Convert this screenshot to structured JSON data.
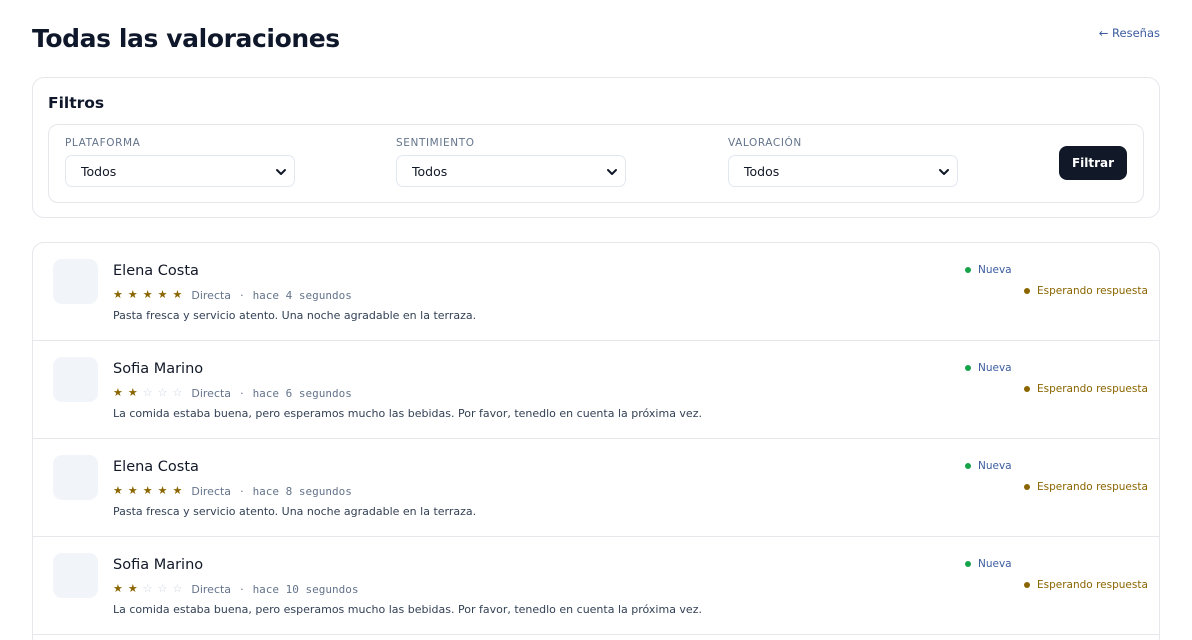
{
  "header": {
    "title": "Todas las valoraciones",
    "back_link": "← Reseñas"
  },
  "filters": {
    "title": "Filtros",
    "platform": {
      "label": "PLATAFORMA",
      "value": "Todos"
    },
    "sentiment": {
      "label": "SENTIMIENTO",
      "value": "Todos"
    },
    "rating": {
      "label": "VALORACIÓN",
      "value": "Todos"
    },
    "button_label": "Filtrar"
  },
  "colors": {
    "star_filled": "#8a6500",
    "star_empty": "#cbd5e1",
    "status_new_dot": "#16a34a",
    "status_wait_dot": "#8a6500",
    "button_bg": "#111827"
  },
  "icons": {
    "star": "★",
    "star_empty": "☆",
    "chevron": "chevron-down-icon"
  },
  "reviews": [
    {
      "name": "Elena Costa",
      "rating": 5,
      "max_rating": 5,
      "platform": "Directa",
      "separator": "·",
      "time": "hace 4 segundos",
      "text": "Pasta fresca y servicio atento. Una noche agradable en la terraza.",
      "status_new": "Nueva",
      "status_wait": "Esperando respuesta"
    },
    {
      "name": "Sofia Marino",
      "rating": 2,
      "max_rating": 5,
      "platform": "Directa",
      "separator": "·",
      "time": "hace 6 segundos",
      "text": "La comida estaba buena, pero esperamos mucho las bebidas. Por favor, tenedlo en cuenta la próxima vez.",
      "status_new": "Nueva",
      "status_wait": "Esperando respuesta"
    },
    {
      "name": "Elena Costa",
      "rating": 5,
      "max_rating": 5,
      "platform": "Directa",
      "separator": "·",
      "time": "hace 8 segundos",
      "text": "Pasta fresca y servicio atento. Una noche agradable en la terraza.",
      "status_new": "Nueva",
      "status_wait": "Esperando respuesta"
    },
    {
      "name": "Sofia Marino",
      "rating": 2,
      "max_rating": 5,
      "platform": "Directa",
      "separator": "·",
      "time": "hace 10 segundos",
      "text": "La comida estaba buena, pero esperamos mucho las bebidas. Por favor, tenedlo en cuenta la próxima vez.",
      "status_new": "Nueva",
      "status_wait": "Esperando respuesta"
    }
  ]
}
